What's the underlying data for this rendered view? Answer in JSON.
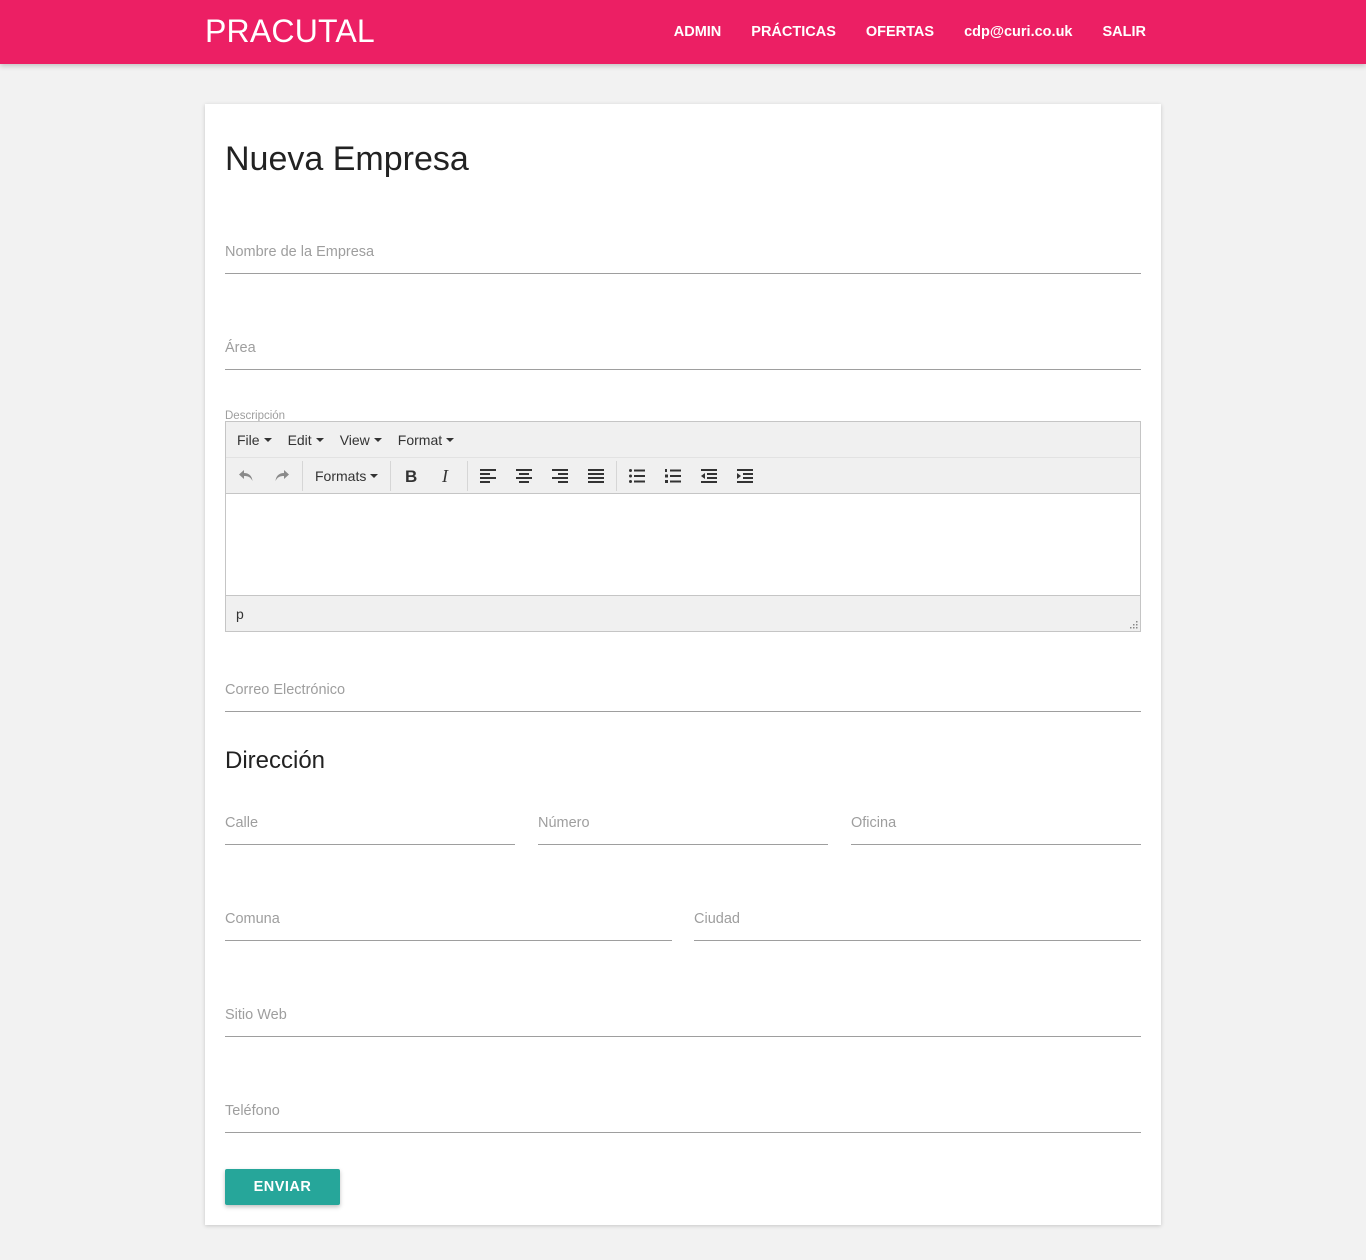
{
  "nav": {
    "brand": "PRACUTAL",
    "links": [
      "ADMIN",
      "PRÁCTICAS",
      "OFERTAS",
      "cdp@curi.co.uk",
      "SALIR"
    ]
  },
  "form": {
    "title": "Nueva Empresa",
    "nombre_label": "Nombre de la Empresa",
    "area_label": "Área",
    "descripcion_label": "Descripción",
    "correo_label": "Correo Electrónico",
    "direccion_title": "Dirección",
    "calle_label": "Calle",
    "numero_label": "Número",
    "oficina_label": "Oficina",
    "comuna_label": "Comuna",
    "ciudad_label": "Ciudad",
    "sitio_label": "Sitio Web",
    "telefono_label": "Teléfono",
    "submit_label": "ENVIAR"
  },
  "editor": {
    "menus": [
      "File",
      "Edit",
      "View",
      "Format"
    ],
    "formats_label": "Formats",
    "status_path": "p",
    "toolbar_icons": [
      "undo-icon",
      "redo-icon",
      "bold-icon",
      "italic-icon",
      "align-left-icon",
      "align-center-icon",
      "align-right-icon",
      "align-justify-icon",
      "bullet-list-icon",
      "numbered-list-icon",
      "outdent-icon",
      "indent-icon"
    ]
  },
  "colors": {
    "navbar": "#ec1f64",
    "button": "#26a69a"
  }
}
